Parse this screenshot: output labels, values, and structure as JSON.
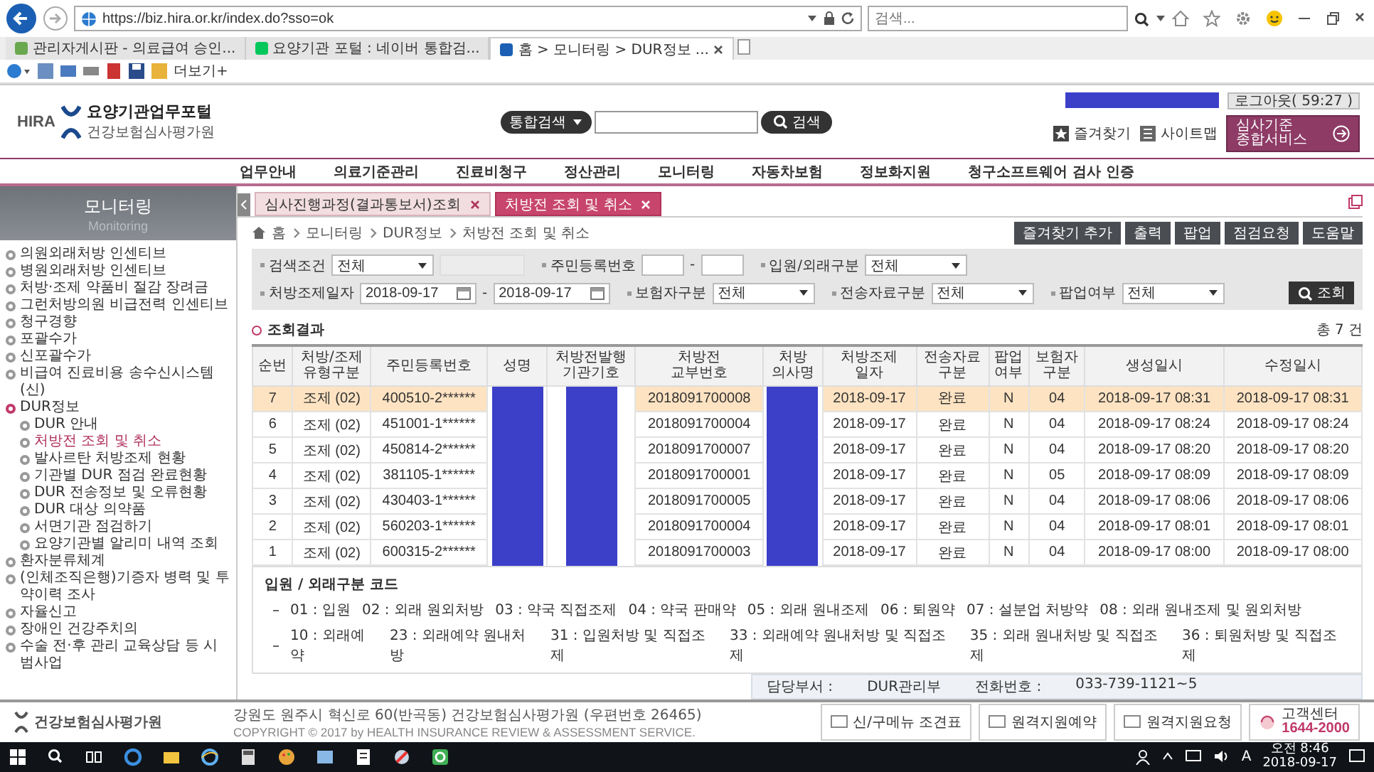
{
  "browser": {
    "address": "https://biz.hira.or.kr/index.do?sso=ok",
    "search_placeholder": "검색...",
    "tabs": [
      {
        "label": "관리자게시판 - 의료급여 승인...",
        "selected": false
      },
      {
        "label": "요양기관 포털 : 네이버 통합검...",
        "selected": false
      },
      {
        "label": "홈 > 모니터링 > DUR정보 ...",
        "selected": true
      }
    ],
    "toolbar_more": "더보기+"
  },
  "header": {
    "logo_text": "HIRA",
    "portal_name": "요양기관업무포털",
    "org_name": "건강보험심사평가원",
    "search_scope": "통합검색",
    "search_button": "검색",
    "user_name_redacted": true,
    "logout": "로그아웃( 59:27 )",
    "links": [
      "즐겨찾기",
      "사이트맵"
    ],
    "service_button": "심사기준\n종합서비스",
    "nav": [
      "업무안내",
      "의료기준관리",
      "진료비청구",
      "정산관리",
      "모니터링",
      "자동차보험",
      "정보화지원",
      "청구소프트웨어 검사 인증"
    ]
  },
  "sidebar": {
    "title": "모니터링",
    "subtitle": "Monitoring",
    "items": [
      {
        "label": "의원외래처방 인센티브",
        "selected": false,
        "expanded": false
      },
      {
        "label": "병원외래처방 인센티브",
        "selected": false,
        "expanded": false
      },
      {
        "label": "처방·조제 약품비 절감 장려금",
        "selected": false,
        "expanded": false
      },
      {
        "label": "그런처방의원 비급전력 인센티브",
        "selected": false,
        "expanded": false
      },
      {
        "label": "청구경향",
        "selected": false,
        "expanded": false
      },
      {
        "label": "포괄수가",
        "selected": false,
        "expanded": false
      },
      {
        "label": "신포괄수가",
        "selected": false,
        "expanded": false
      },
      {
        "label": "비급여 진료비용 송수신시스템(신)",
        "selected": false,
        "expanded": false
      },
      {
        "label": "DUR정보",
        "selected": false,
        "expanded": true,
        "children": [
          {
            "label": "DUR 안내",
            "selected": false
          },
          {
            "label": "처방전 조회 및 취소",
            "selected": true
          },
          {
            "label": "발사르탄 처방조제 현황",
            "selected": false
          },
          {
            "label": "기관별 DUR 점검 완료현황",
            "selected": false
          },
          {
            "label": "DUR 전송정보 및 오류현황",
            "selected": false
          },
          {
            "label": "DUR 대상 의약품",
            "selected": false
          },
          {
            "label": "서면기관 점검하기",
            "selected": false
          },
          {
            "label": "요양기관별 알리미 내역 조회",
            "selected": false
          }
        ]
      },
      {
        "label": "환자분류체계",
        "selected": false,
        "expanded": false
      },
      {
        "label": "(인체조직은행)기증자 병력 및 투약이력 조사",
        "selected": false,
        "expanded": false
      },
      {
        "label": "자율신고",
        "selected": false,
        "expanded": false
      },
      {
        "label": "장애인 건강주치의",
        "selected": false,
        "expanded": false
      },
      {
        "label": "수술 전·후 관리 교육상담 등 시범사업",
        "selected": false,
        "expanded": false
      }
    ]
  },
  "content": {
    "tabs": [
      {
        "label": "심사진행과정(결과통보서)조회",
        "selected": false
      },
      {
        "label": "처방전 조회 및 취소",
        "selected": true
      }
    ],
    "breadcrumb": [
      "홈",
      "모니터링",
      "DUR정보",
      "처방전 조회 및 취소"
    ],
    "actions": [
      "즐겨찾기 추가",
      "출력",
      "팝업",
      "점검요청",
      "도움말"
    ],
    "search": {
      "rows": [
        [
          {
            "label": "검색조건",
            "controls": [
              {
                "kind": "select",
                "value": "전체"
              },
              {
                "kind": "text",
                "disabled": true
              }
            ]
          },
          {
            "label": "주민등록번호",
            "joiner": "-",
            "controls": [
              {
                "kind": "text",
                "disabled": false
              },
              {
                "kind": "text",
                "disabled": false
              }
            ]
          },
          {
            "label": "입원/외래구분",
            "controls": [
              {
                "kind": "select",
                "value": "전체"
              }
            ]
          }
        ],
        [
          {
            "label": "처방조제일자",
            "joiner": "-",
            "controls": [
              {
                "kind": "date",
                "value": "2018-09-17"
              },
              {
                "kind": "date",
                "value": "2018-09-17"
              }
            ]
          },
          {
            "label": "보험자구분",
            "controls": [
              {
                "kind": "select",
                "value": "전체"
              }
            ]
          },
          {
            "label": "전송자료구분",
            "controls": [
              {
                "kind": "select",
                "value": "전체"
              }
            ]
          },
          {
            "label": "팝업여부",
            "controls": [
              {
                "kind": "select",
                "value": "전체"
              }
            ]
          }
        ]
      ],
      "button": "조회"
    },
    "results": {
      "title": "조회결과",
      "total": "총 7 건",
      "columns": [
        {
          "label": "순번",
          "redacted": false
        },
        {
          "label": "처방/조제\n유형구분",
          "redacted": false
        },
        {
          "label": "주민등록번호",
          "redacted": false
        },
        {
          "label": "성명",
          "redacted": true
        },
        {
          "label": "처방전발행\n기관기호",
          "redacted": true
        },
        {
          "label": "처방전\n교부번호",
          "redacted": false
        },
        {
          "label": "처방\n의사명",
          "redacted": true
        },
        {
          "label": "처방조제\n일자",
          "redacted": false
        },
        {
          "label": "전송자료\n구분",
          "redacted": false
        },
        {
          "label": "팝업\n여부",
          "redacted": false
        },
        {
          "label": "보험자\n구분",
          "redacted": false
        },
        {
          "label": "생성일시",
          "redacted": false
        },
        {
          "label": "수정일시",
          "redacted": false
        }
      ],
      "rows": [
        {
          "selected": true,
          "cells": [
            "7",
            "조제 (02)",
            "400510-2******",
            "",
            "",
            "2018091700008",
            "",
            "2018-09-17",
            "완료",
            "N",
            "04",
            "2018-09-17 08:31",
            "2018-09-17 08:31"
          ]
        },
        {
          "selected": false,
          "cells": [
            "6",
            "조제 (02)",
            "451001-1******",
            "",
            "",
            "2018091700004",
            "",
            "2018-09-17",
            "완료",
            "N",
            "04",
            "2018-09-17 08:24",
            "2018-09-17 08:24"
          ]
        },
        {
          "selected": false,
          "cells": [
            "5",
            "조제 (02)",
            "450814-2******",
            "",
            "",
            "2018091700007",
            "",
            "2018-09-17",
            "완료",
            "N",
            "04",
            "2018-09-17 08:20",
            "2018-09-17 08:20"
          ]
        },
        {
          "selected": false,
          "cells": [
            "4",
            "조제 (02)",
            "381105-1******",
            "",
            "",
            "2018091700001",
            "",
            "2018-09-17",
            "완료",
            "N",
            "05",
            "2018-09-17 08:09",
            "2018-09-17 08:09"
          ]
        },
        {
          "selected": false,
          "cells": [
            "3",
            "조제 (02)",
            "430403-1******",
            "",
            "",
            "2018091700005",
            "",
            "2018-09-17",
            "완료",
            "N",
            "04",
            "2018-09-17 08:06",
            "2018-09-17 08:06"
          ]
        },
        {
          "selected": false,
          "cells": [
            "2",
            "조제 (02)",
            "560203-1******",
            "",
            "",
            "2018091700004",
            "",
            "2018-09-17",
            "완료",
            "N",
            "04",
            "2018-09-17 08:01",
            "2018-09-17 08:01"
          ]
        },
        {
          "selected": false,
          "cells": [
            "1",
            "조제 (02)",
            "600315-2******",
            "",
            "",
            "2018091700003",
            "",
            "2018-09-17",
            "완료",
            "N",
            "04",
            "2018-09-17 08:00",
            "2018-09-17 08:00"
          ]
        }
      ]
    },
    "legend": {
      "title": "입원 / 외래구분 코드",
      "lines": [
        [
          "01 : 입원",
          "02 : 외래 원외처방",
          "03 : 약국 직접조제",
          "04 : 약국 판매약",
          "05 : 외래 원내조제",
          "06 : 퇴원약",
          "07 : 설분업 처방약",
          "08 : 외래 원내조제 및 원외처방"
        ],
        [
          "10 : 외래예약",
          "23 : 외래예약 원내처방",
          "31 : 입원처방 및 직접조제",
          "33 : 외래예약 원내처방 및 직접조제",
          "35 : 외래 원내처방 및 직접조제",
          "36 : 퇴원처방 및 직접조제"
        ]
      ]
    },
    "contact": [
      {
        "label": "담당부서 :",
        "value": "DUR관리부"
      },
      {
        "label": "전화번호 :",
        "value": "033-739-1121~5"
      }
    ]
  },
  "footer": {
    "org_name": "건강보험심사평가원",
    "address": "강원도 원주시 혁신로 60(반곡동) 건강보험심사평가원 (우편번호 26465)",
    "copyright": "COPYRIGHT © 2017 by HEALTH INSURANCE REVIEW & ASSESSMENT SERVICE.",
    "buttons": [
      "신/구메뉴 조견표",
      "원격지원예약",
      "원격지원요청"
    ],
    "call_center_label": "고객센터",
    "call_center_number": "1644-2000"
  },
  "taskbar": {
    "ime": "A",
    "time": "오전 8:46",
    "date": "2018-09-17"
  }
}
